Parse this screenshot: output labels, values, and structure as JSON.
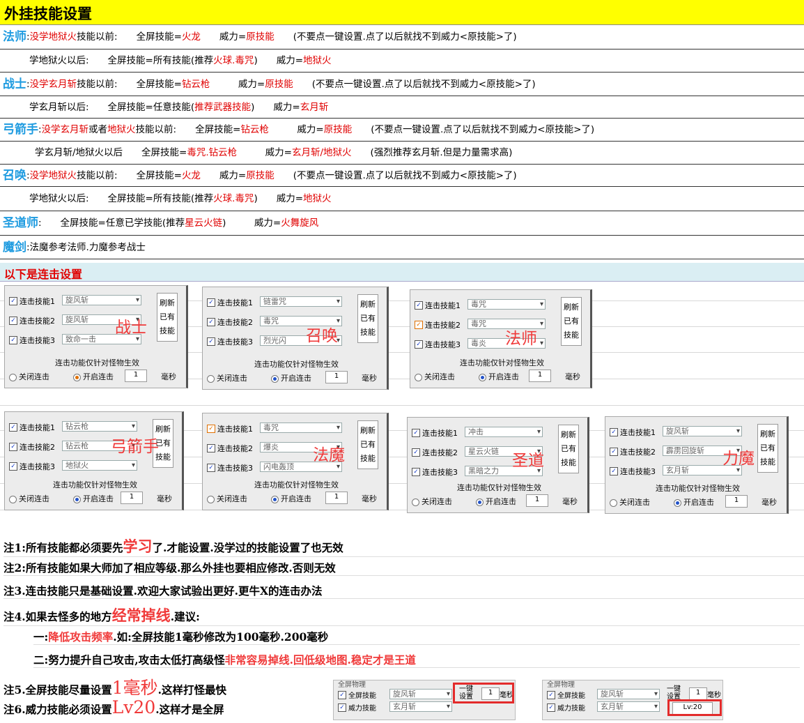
{
  "title": "外挂技能设置",
  "rows": [
    {
      "cls": "法师",
      "parts": [
        [
          ":",
          0
        ],
        [
          "没学地狱火",
          1
        ],
        [
          "技能以前:　　全屏技能=",
          0
        ],
        [
          "火龙",
          1
        ],
        [
          "　　威力=",
          0
        ],
        [
          "原技能",
          1
        ],
        [
          "　　(不要点一键设置.点了以后就找不到威力<原技能>了)",
          0
        ]
      ]
    },
    {
      "cls": "",
      "parts": [
        [
          "学地狱火以后:　　全屏技能=所有技能(推荐",
          0
        ],
        [
          "火球.毒咒",
          1
        ],
        [
          ")　　威力=",
          0
        ],
        [
          "地狱火",
          1
        ]
      ]
    },
    {
      "cls": "战士",
      "parts": [
        [
          ":",
          0
        ],
        [
          "没学玄月斩",
          1
        ],
        [
          "技能以前:　　全屏技能=",
          0
        ],
        [
          "钻云枪",
          1
        ],
        [
          "　　　威力=",
          0
        ],
        [
          "原技能",
          1
        ],
        [
          "　　(不要点一键设置.点了以后就找不到威力<原技能>了)",
          0
        ]
      ]
    },
    {
      "cls": "",
      "parts": [
        [
          "学玄月斩以后:　　全屏技能=任意技能(",
          0
        ],
        [
          "推荐武器技能",
          1
        ],
        [
          ")　　威力=",
          0
        ],
        [
          "玄月斩",
          1
        ]
      ]
    },
    {
      "cls": "弓箭手",
      "parts": [
        [
          ":",
          0
        ],
        [
          "没学玄月斩",
          1
        ],
        [
          "或者",
          0
        ],
        [
          "地狱火",
          1
        ],
        [
          "技能以前:　　全屏技能=",
          0
        ],
        [
          "钻云枪",
          1
        ],
        [
          "　　　威力=",
          0
        ],
        [
          "原技能",
          1
        ],
        [
          "　　(不要点一键设置.点了以后就找不到威力<原技能>了)",
          0
        ]
      ]
    },
    {
      "cls": "",
      "parts": [
        [
          "学玄月斩/地狱火以后　　全屏技能=",
          0
        ],
        [
          "毒咒.钻云枪",
          1
        ],
        [
          "　　　威力=",
          0
        ],
        [
          "玄月斩/地狱火",
          1
        ],
        [
          "　　(强烈推荐玄月斩.但是力量需求高)",
          0
        ]
      ]
    },
    {
      "cls": "召唤",
      "parts": [
        [
          ":",
          0
        ],
        [
          "没学地狱火",
          1
        ],
        [
          "技能以前:　　全屏技能=",
          0
        ],
        [
          "火龙",
          1
        ],
        [
          "　　威力=",
          0
        ],
        [
          "原技能",
          1
        ],
        [
          "　　(不要点一键设置.点了以后就找不到威力<原技能>了)",
          0
        ]
      ]
    },
    {
      "cls": "",
      "parts": [
        [
          "学地狱火以后:　　全屏技能=所有技能(推荐",
          0
        ],
        [
          "火球.毒咒",
          1
        ],
        [
          ")　　威力=",
          0
        ],
        [
          "地狱火",
          1
        ]
      ]
    },
    {
      "cls": "圣道师",
      "parts": [
        [
          ":　　全屏技能=任意已学技能(推荐",
          0
        ],
        [
          "星云火链",
          1
        ],
        [
          ")　　　威力=",
          0
        ],
        [
          "火舞旋风",
          1
        ]
      ]
    },
    {
      "cls": "魔剑",
      "parts": [
        [
          ":法魔参考法师.力魔参考战士",
          0
        ]
      ]
    }
  ],
  "combo_title": "以下是连击设置",
  "panel_common": {
    "label1": "连击技能1",
    "label2": "连击技能2",
    "label3": "连击技能3",
    "refresh": [
      "刷新",
      "已有",
      "技能"
    ],
    "footer": "连击功能仅针对怪物生效",
    "off": "关闭连击",
    "on": "开启连击",
    "value": "1",
    "unit": "毫秒"
  },
  "panels": [
    {
      "tag": "战士",
      "skills": [
        "旋风斩",
        "旋风斩",
        "致命一击"
      ],
      "orange": false
    },
    {
      "tag": "召唤",
      "skills": [
        "链雷咒",
        "毒咒",
        "烈光闪"
      ],
      "orange": false
    },
    {
      "tag": "法师",
      "skills": [
        "毒咒",
        "毒咒",
        "毒炎"
      ],
      "orange": true
    },
    {
      "tag": "弓箭手",
      "skills": [
        "钻云枪",
        "钻云枪",
        "地狱火"
      ],
      "orange": false
    },
    {
      "tag": "法魔",
      "skills": [
        "毒咒",
        "爆炎",
        "闪电轰顶"
      ],
      "orange": true
    },
    {
      "tag": "圣道",
      "skills": [
        "冲击",
        "星云火链",
        "黑暗之力"
      ],
      "orange": false
    },
    {
      "tag": "力魔",
      "skills": [
        "旋风斩",
        "霹雳回旋斩",
        "玄月斩"
      ],
      "orange": false
    }
  ],
  "notes": {
    "n1a": "注1:所有技能都必须要先",
    "n1b": "学习",
    "n1c": "了.才能设置.没学过的技能设置了也无效",
    "n2": "注2:所有技能如果大师加了相应等级.那么外挂也要相应修改.否则无效",
    "n3": "注3.连击技能只是基础设置.欢迎大家试验出更好.更牛X的连击办法",
    "n4a": "注4.如果去怪多的地方",
    "n4b": "经常掉线",
    "n4c": ".建议:",
    "s1a": "一:",
    "s1b": "降低攻击频率",
    "s1c": ".如:全屏技能1毫秒修改为100毫秒.200毫秒",
    "s2a": "二:努力提升自己攻击,攻击太低打高级怪",
    "s2b": "非常容易掉线.回低级地图.稳定才是王道",
    "n5a": "注5.全屏技能尽量设置",
    "n5b": "1毫秒",
    "n5c": ".这样打怪最快",
    "n6a": "注6.威力技能必须设置",
    "n6b": "Lv20",
    "n6c": ".这样才是全屏"
  },
  "mini": {
    "top": "全屏物理",
    "full": "全屏技能",
    "power": "威力技能",
    "skill1": "旋风斩",
    "skill2": "玄月斩",
    "yijian": "一键",
    "shezhi": "设置",
    "val": "1",
    "ms": "毫秒",
    "lv": "Lv:20"
  }
}
